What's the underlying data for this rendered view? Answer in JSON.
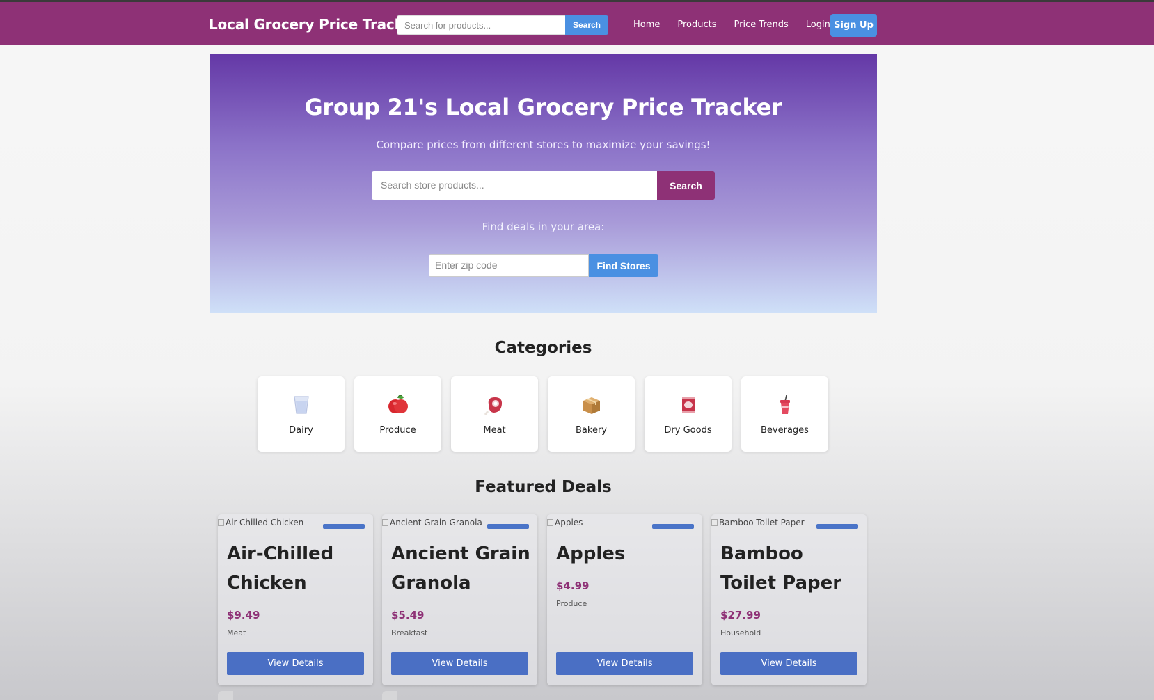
{
  "navbar": {
    "brand": "Local Grocery Price Tracker",
    "search_placeholder": "Search for products...",
    "search_button": "Search",
    "links": [
      "Home",
      "Products",
      "Price Trends",
      "Login"
    ],
    "signup": "Sign Up"
  },
  "hero": {
    "title": "Group 21's Local Grocery Price Tracker",
    "subtitle": "Compare prices from different stores to maximize your savings!",
    "search_placeholder": "Search store products...",
    "search_button": "Search",
    "area_label": "Find deals in your area:",
    "zip_placeholder": "Enter zip code",
    "zip_button": "Find Stores"
  },
  "categories": {
    "title": "Categories",
    "items": [
      {
        "label": "Dairy",
        "icon": "milk-glass-icon"
      },
      {
        "label": "Produce",
        "icon": "apple-icon"
      },
      {
        "label": "Meat",
        "icon": "meat-icon"
      },
      {
        "label": "Bakery",
        "icon": "box-icon"
      },
      {
        "label": "Dry Goods",
        "icon": "can-icon"
      },
      {
        "label": "Beverages",
        "icon": "drink-cup-icon"
      }
    ]
  },
  "featured": {
    "title": "Featured Deals",
    "deals": [
      {
        "alt": "Air-Chilled Chicken",
        "name": "Air-Chilled Chicken",
        "price": "$9.49",
        "category": "Meat",
        "button": "View Details"
      },
      {
        "alt": "Ancient Grain Granola",
        "name": "Ancient Grain Granola",
        "price": "$5.49",
        "category": "Breakfast",
        "button": "View Details"
      },
      {
        "alt": "Apples",
        "name": "Apples",
        "price": "$4.99",
        "category": "Produce",
        "button": "View Details"
      },
      {
        "alt": "Bamboo Toilet Paper",
        "name": "Bamboo Toilet Paper",
        "price": "$27.99",
        "category": "Household",
        "button": "View Details"
      }
    ]
  },
  "colors": {
    "navbar": "#8e3176",
    "accent_blue": "#4a90e2",
    "price": "#8e3176",
    "hero_top": "#6438a6",
    "hero_bottom": "#cfe0f8"
  }
}
